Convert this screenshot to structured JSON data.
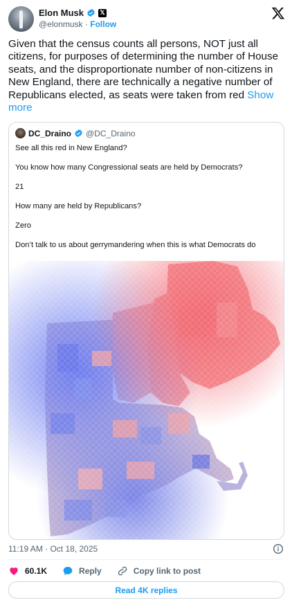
{
  "author": {
    "name": "Elon Musk",
    "handle": "@elonmusk",
    "separator": "·",
    "follow_label": "Follow",
    "badge_glyph": "𝕏"
  },
  "tweet": {
    "text": "Given that the census counts all persons, NOT just all citizens, for purposes of determining the number of House seats, and the disproportionate number of non-citizens in New England, there are technically a negative number of Republicans elected, as seats were taken from red",
    "show_more": "Show more"
  },
  "quote": {
    "name": "DC_Draino",
    "handle": "@DC_Draino",
    "lines": [
      "See all this red in New England?",
      "You know how many Congressional seats are held by Democrats?",
      "21",
      "How many are held by Republicans?",
      "Zero",
      "Don’t talk to us about gerrymandering when this is what Democrats do"
    ]
  },
  "footer": {
    "timestamp": "11:19 AM · Oct 18, 2025",
    "likes": "60.1K",
    "reply_label": "Reply",
    "copy_label": "Copy link to post",
    "read_replies": "Read 4K replies"
  },
  "colors": {
    "accent": "#1d9bf0",
    "like": "#f91880",
    "muted": "#536471",
    "map_red": "#f27f84",
    "map_blue": "#7d8cf0"
  },
  "icons": [
    "verified-icon",
    "x-logo-icon",
    "info-icon",
    "heart-icon",
    "reply-icon",
    "link-icon"
  ]
}
